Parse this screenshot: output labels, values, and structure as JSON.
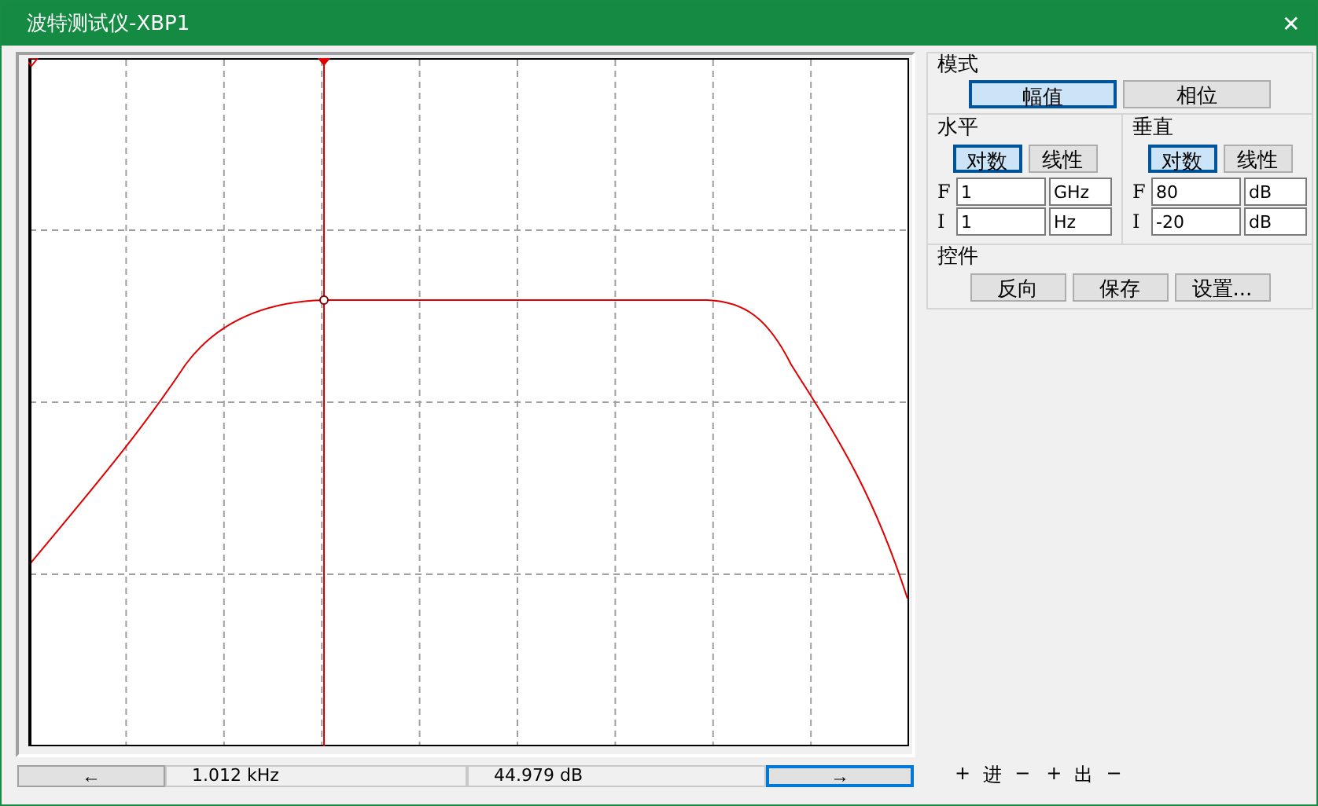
{
  "window": {
    "title": "波特测试仪-XBP1",
    "close": "✕"
  },
  "mode": {
    "label": "模式",
    "buttons": [
      {
        "label": "幅值",
        "selected": true
      },
      {
        "label": "相位",
        "selected": false
      }
    ]
  },
  "horizontal": {
    "label": "水平",
    "buttons": [
      {
        "label": "对数",
        "selected": true
      },
      {
        "label": "线性",
        "selected": false
      }
    ],
    "fields": [
      {
        "label": "F",
        "value": "1",
        "unit": "GHz"
      },
      {
        "label": "I",
        "value": "1",
        "unit": "Hz"
      }
    ]
  },
  "vertical": {
    "label": "垂直",
    "buttons": [
      {
        "label": "对数",
        "selected": true
      },
      {
        "label": "线性",
        "selected": false
      }
    ],
    "fields": [
      {
        "label": "F",
        "value": "80",
        "unit": "dB"
      },
      {
        "label": "I",
        "value": "-20",
        "unit": "dB"
      }
    ]
  },
  "controls": {
    "label": "控件",
    "buttons": [
      "反向",
      "保存",
      "设置..."
    ]
  },
  "readout": {
    "left_button": {
      "label": "←",
      "focused": false
    },
    "frequency": "1.012 kHz",
    "magnitude": "44.979 dB",
    "right_button": {
      "label": "→",
      "focused": true
    }
  },
  "terminals": [
    {
      "sign": "+",
      "label": "进",
      "minus": "−"
    },
    {
      "sign": "+",
      "label": "出",
      "minus": "−"
    }
  ]
}
